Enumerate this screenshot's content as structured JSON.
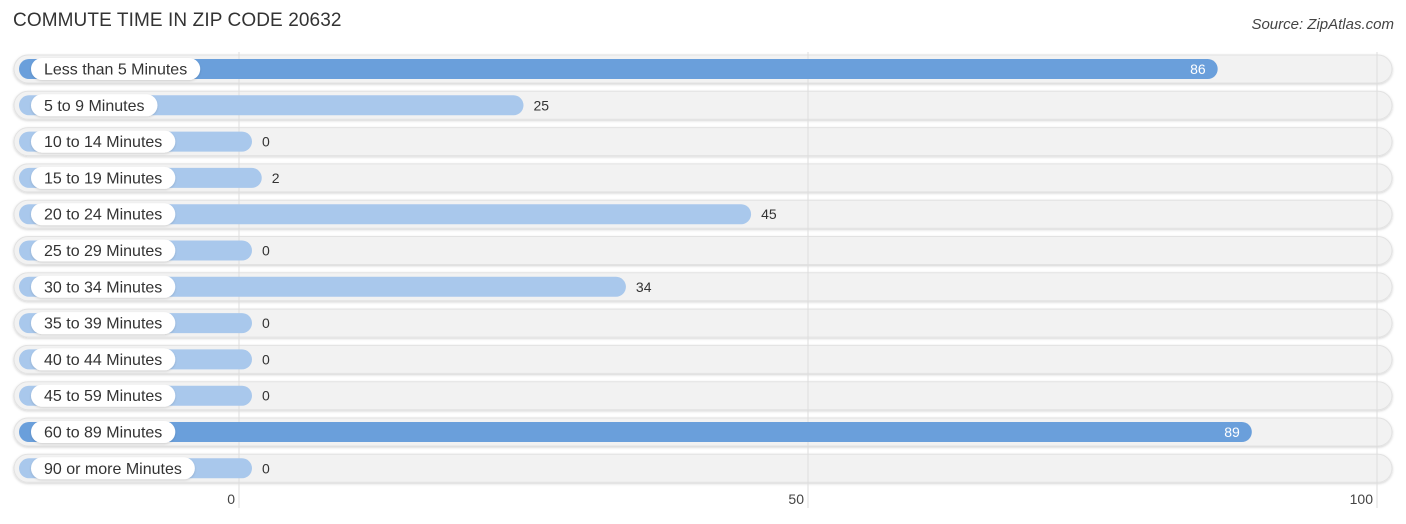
{
  "chart_data": {
    "type": "bar",
    "orientation": "horizontal",
    "title": "COMMUTE TIME IN ZIP CODE 20632",
    "source": "Source: ZipAtlas.com",
    "categories": [
      "Less than 5 Minutes",
      "5 to 9 Minutes",
      "10 to 14 Minutes",
      "15 to 19 Minutes",
      "20 to 24 Minutes",
      "25 to 29 Minutes",
      "30 to 34 Minutes",
      "35 to 39 Minutes",
      "40 to 44 Minutes",
      "45 to 59 Minutes",
      "60 to 89 Minutes",
      "90 or more Minutes"
    ],
    "values": [
      86,
      25,
      0,
      2,
      45,
      0,
      34,
      0,
      0,
      0,
      89,
      0
    ],
    "value_labels": [
      "86",
      "25",
      "0",
      "2",
      "45",
      "0",
      "34",
      "0",
      "0",
      "0",
      "89",
      "0"
    ],
    "xlim": [
      0,
      100
    ],
    "xticks": [
      0,
      50,
      100
    ],
    "xtick_labels": [
      "0",
      "50",
      "100"
    ],
    "xlabel": "",
    "ylabel": "",
    "grid": true,
    "legend": "none",
    "colors": {
      "bar_strong": "#6a9fdb",
      "bar_light": "#a9c8ec",
      "track": "#f2f2f2",
      "grid": "#dddddd"
    }
  }
}
